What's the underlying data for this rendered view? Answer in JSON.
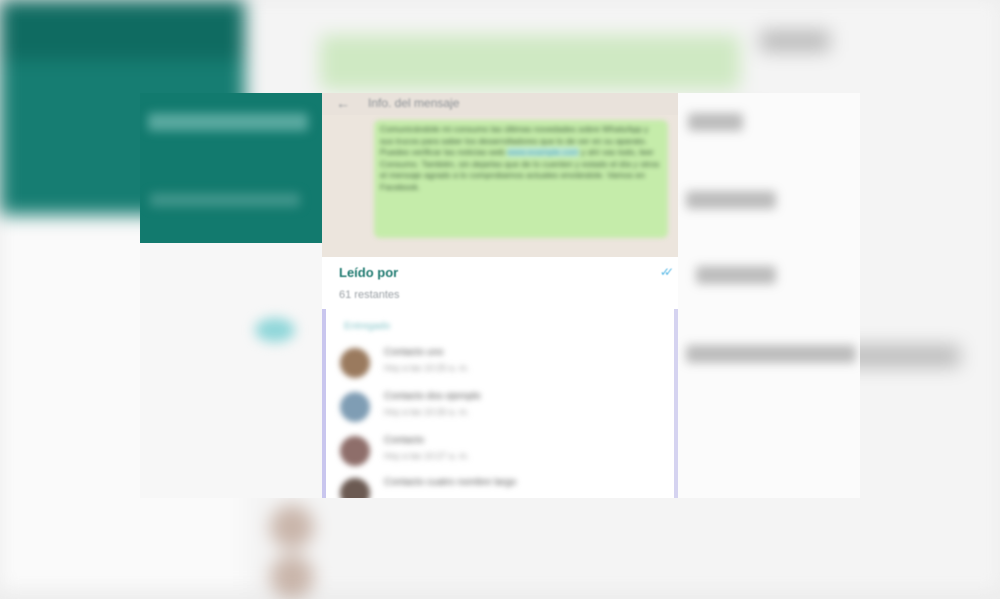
{
  "colors": {
    "teal": "#127a6e",
    "bubble_green": "#c5ecaa",
    "read_title": "#1f7a70",
    "check_blue": "#56b8e6",
    "chat_bg": "#ece5dd"
  },
  "header": {
    "back_icon": "←",
    "title": "Info. del mensaje"
  },
  "message": {
    "text_before_link": "Comunicándole mi consumo las últimas novedades sobre WhatsApp y sus trucos para saber los desarrolladores que lo de ver en su aparato. Puedes verificar las noticias web ",
    "link": "www.example.com",
    "text_after_link": " y ahí vas todo, leer Consumo. También, sin dejarlas que de lo cuenten y estado el día y otros el mensaje agrado a lo comprobamos actuales enviándole. Vamos en Facebook."
  },
  "read_by": {
    "title": "Leído por",
    "remaining": "61 restantes",
    "check_icon": "✓✓"
  },
  "list": {
    "header": "Entregado",
    "contacts": [
      {
        "name": "Contacto uno",
        "time": "Hoy a las 10:25 a. m.",
        "avatar_color": "#9a7a5e"
      },
      {
        "name": "Contacto dos ejemplo",
        "time": "Hoy a las 10:26 a. m.",
        "avatar_color": "#7f9db4"
      },
      {
        "name": "Contacto",
        "time": "Hoy a las 10:27 a. m.",
        "avatar_color": "#8e6e6a"
      },
      {
        "name": "Contacto cuatro nombre largo",
        "time": "",
        "avatar_color": "#6b5a52"
      }
    ]
  }
}
